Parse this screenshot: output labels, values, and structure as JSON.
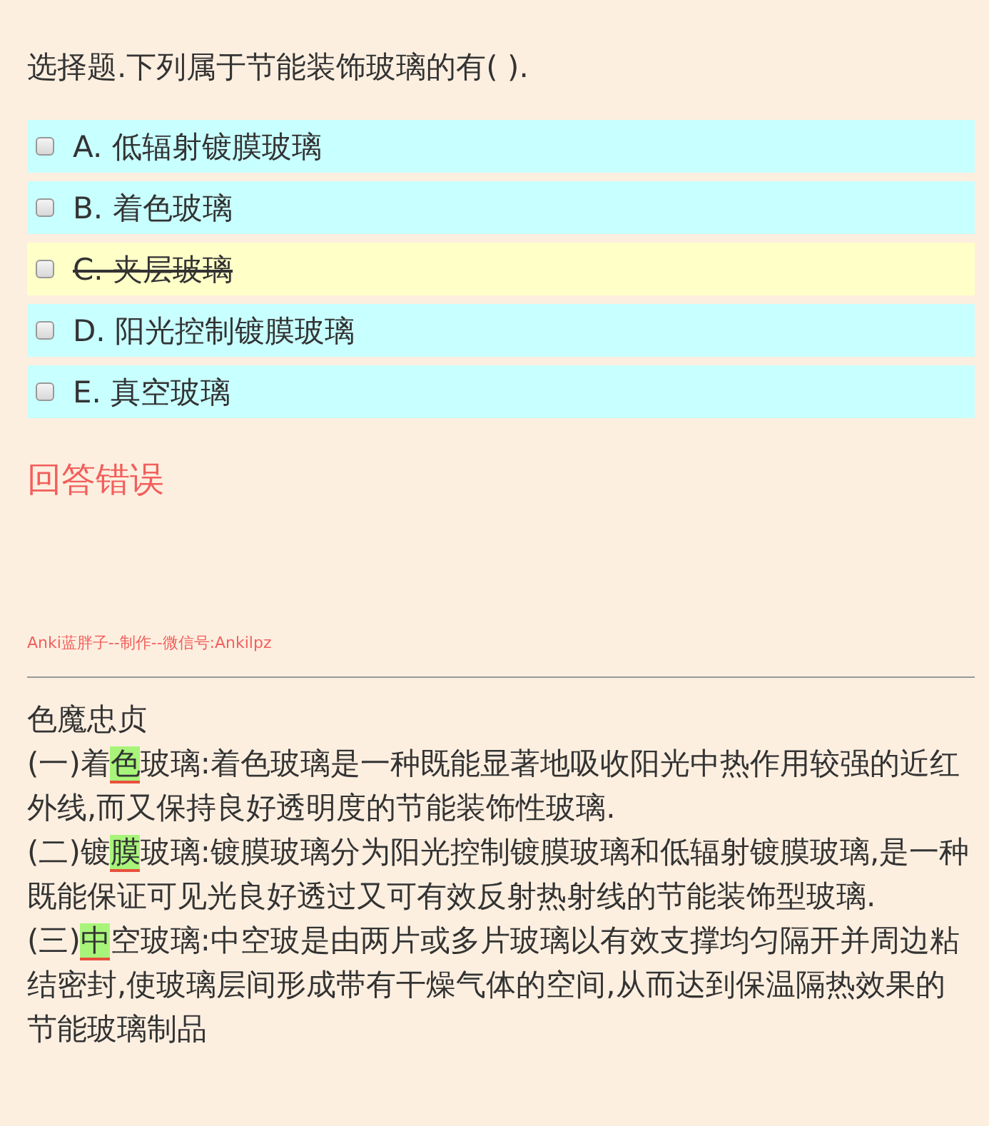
{
  "question": "选择题.下列属于节能装饰玻璃的有( ).",
  "options": [
    {
      "label": "A. 低辐射镀膜玻璃",
      "checked": false,
      "struck": false
    },
    {
      "label": "B. 着色玻璃",
      "checked": false,
      "struck": false
    },
    {
      "label": "C. 夹层玻璃",
      "checked": false,
      "struck": true
    },
    {
      "label": "D. 阳光控制镀膜玻璃",
      "checked": false,
      "struck": false
    },
    {
      "label": "E. 真空玻璃",
      "checked": false,
      "struck": false
    }
  ],
  "result": "回答错误",
  "credit": "Anki蓝胖子--制作--微信号:Ankilpz",
  "explanation": [
    [
      {
        "text": "色魔忠贞",
        "highlighted": false
      }
    ],
    [
      {
        "text": "(一)着",
        "highlighted": false
      },
      {
        "text": "色",
        "highlighted": true
      },
      {
        "text": "玻璃:着色玻璃是一种既能显著地吸收阳光中热作用较强的近红外线,而又保持良好透明度的节能装饰性玻璃.",
        "highlighted": false
      }
    ],
    [
      {
        "text": " (二)镀",
        "highlighted": false
      },
      {
        "text": "膜",
        "highlighted": true
      },
      {
        "text": "玻璃:镀膜玻璃分为阳光控制镀膜玻璃和低辐射镀膜玻璃,是一种既能保证可见光良好透过又可有效反射热射线的节能装饰型玻璃.",
        "highlighted": false
      }
    ],
    [
      {
        "text": " (三)",
        "highlighted": false
      },
      {
        "text": "中",
        "highlighted": true
      },
      {
        "text": "空玻璃:中空玻是由两片或多片玻璃以有效支撑均匀隔开并周边粘结密封,使玻璃层间形成带有干燥气体的空间,从而达到保温隔热效果的节能玻璃制品",
        "highlighted": false
      }
    ]
  ]
}
